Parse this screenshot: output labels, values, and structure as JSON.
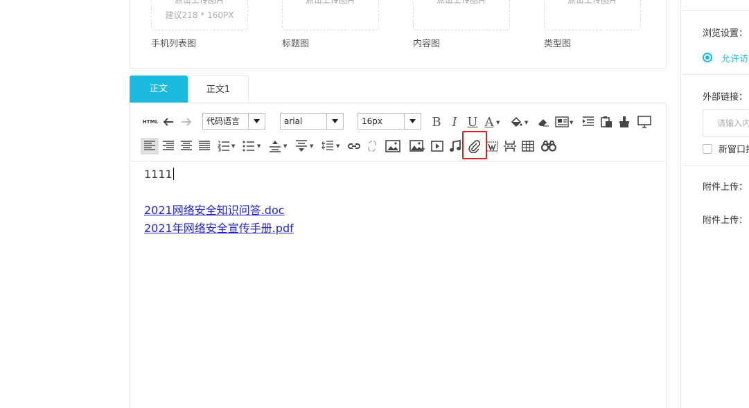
{
  "upload": {
    "slots": [
      {
        "button": "点击上传图片",
        "hint": "建议218 * 160PX",
        "label": "手机列表图"
      },
      {
        "button": "点击上传图片",
        "hint": "",
        "label": "标题图"
      },
      {
        "button": "点击上传图片",
        "hint": "",
        "label": "内容图"
      },
      {
        "button": "点击上传图片",
        "hint": "",
        "label": "类型图"
      }
    ]
  },
  "tabs": [
    {
      "label": "正文",
      "active": true
    },
    {
      "label": "正文1",
      "active": false
    }
  ],
  "toolbar": {
    "html_label": "HTML",
    "code_language": "代码语言",
    "font_family": "arial",
    "font_size": "16px",
    "bold_glyph": "B",
    "italic_glyph": "I",
    "underline_glyph": "U",
    "font_color_glyph": "A",
    "highlighted_tool": "attachment-icon",
    "highlight_color": "#e02020"
  },
  "editor": {
    "line1": "1111",
    "links": [
      "2021网络安全知识问答.doc",
      "2021年网络安全宣传手册.pdf"
    ]
  },
  "sidebar": {
    "browse_label": "浏览设置：",
    "allow_label": "允许访",
    "external_link_label": "外部链接：",
    "external_link_placeholder": "请输入内",
    "new_window_label": "新窗口打",
    "attachment_label_1": "附件上传：",
    "attachment_label_2": "附件上传："
  },
  "colors": {
    "accent": "#1bbbe1",
    "link": "#2222cc"
  }
}
